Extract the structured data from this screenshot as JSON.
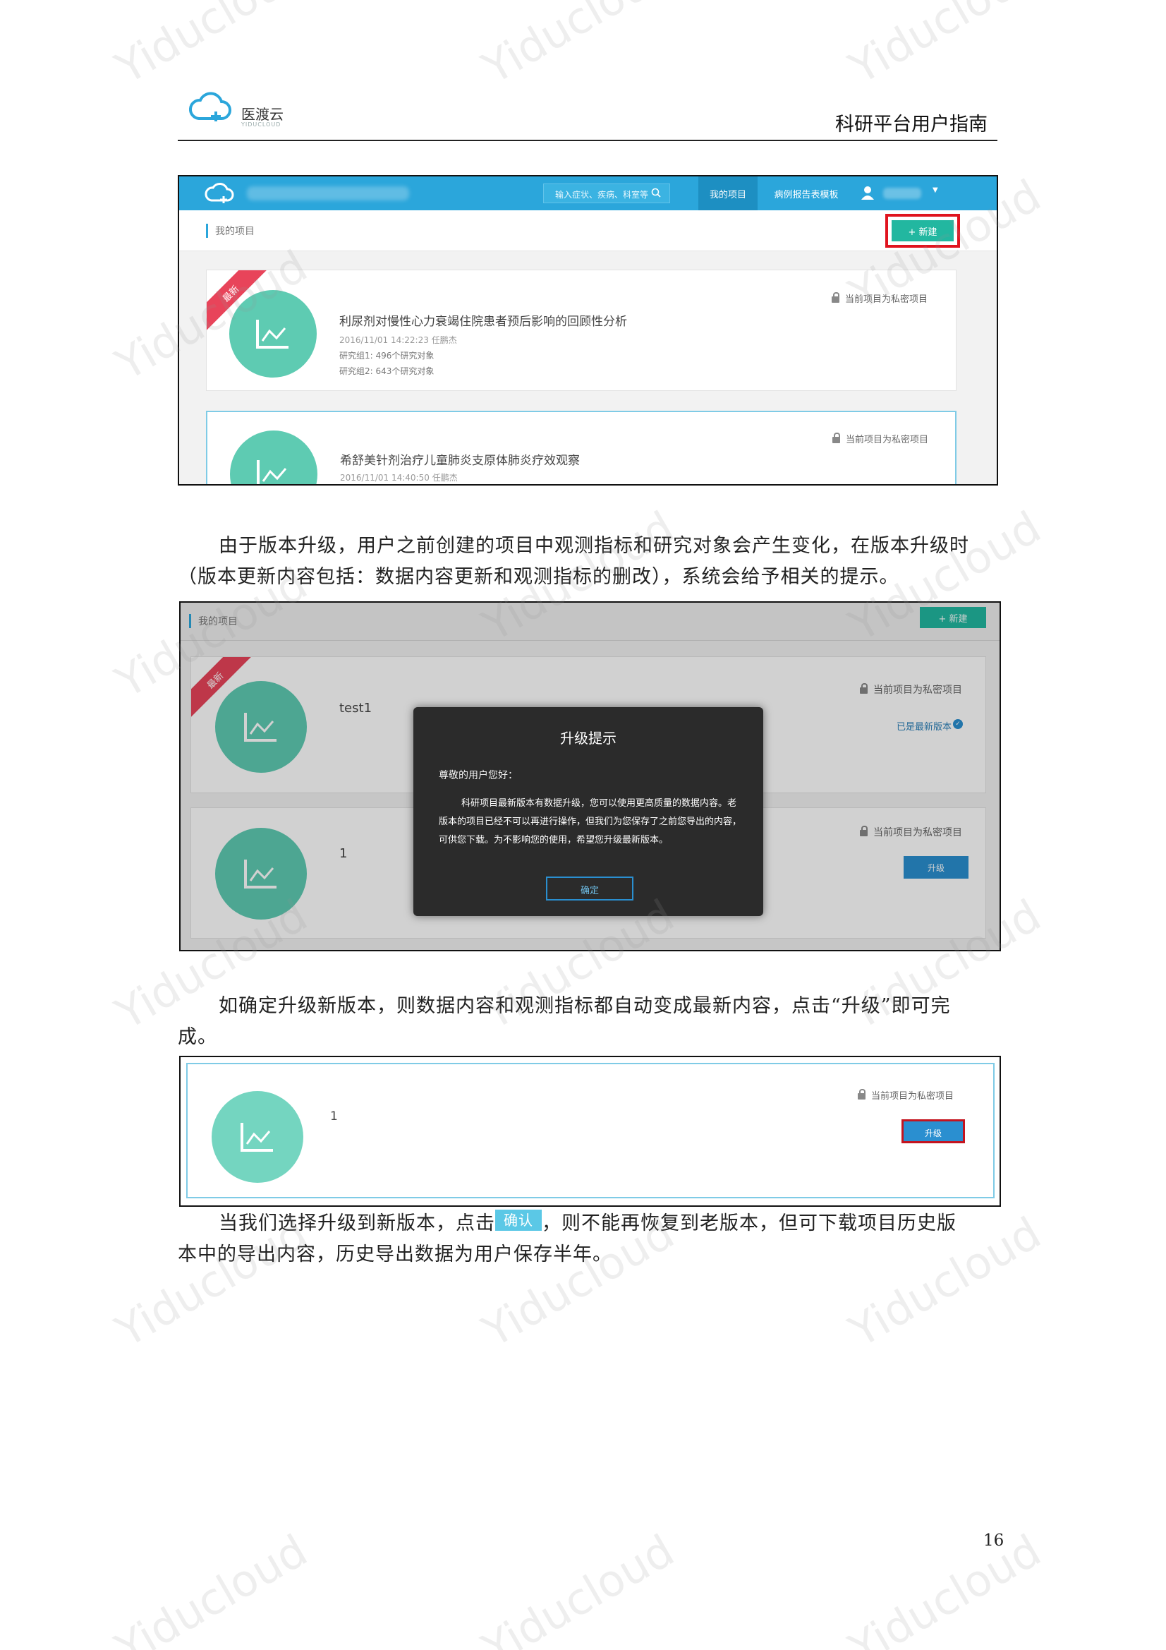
{
  "header": {
    "logo_cn": "医渡云",
    "logo_en": "YIDUCLOUD",
    "doc_title": "科研平台用户指南"
  },
  "figure1": {
    "search_placeholder": "输入症状、疾病、科室等",
    "nav_my_projects": "我的项目",
    "nav_crf_template": "病例报告表模板",
    "page_title": "我的项目",
    "new_button": "+ 新建",
    "projects": [
      {
        "ribbon": "最新",
        "privacy": "当前项目为私密项目",
        "title": "利尿剂对慢性心力衰竭住院患者预后影响的回顾性分析",
        "meta": "2016/11/01 14:22:23 任鹏杰",
        "group1": "研究组1: 496个研究对象",
        "group2": "研究组2: 643个研究对象"
      },
      {
        "privacy": "当前项目为私密项目",
        "title": "希舒美针剂治疗儿童肺炎支原体肺炎疗效观察",
        "meta": "2016/11/01 14:40:50 任鹏杰"
      }
    ]
  },
  "para1": {
    "line1": "由于版本升级，用户之前创建的项目中观测指标和研究对象会产生变化，在版本升级时",
    "line2": "（版本更新内容包括：数据内容更新和观测指标的删改），系统会给予相关的提示。"
  },
  "figure2": {
    "page_title": "我的项目",
    "new_button": "+ 新建",
    "projects": [
      {
        "ribbon": "最新",
        "name": "test1",
        "privacy": "当前项目为私密项目",
        "status": "已是最新版本"
      },
      {
        "name": "1",
        "privacy": "当前项目为私密项目",
        "action": "升级"
      }
    ],
    "modal": {
      "title": "升级提示",
      "greeting": "尊敬的用户您好：",
      "body": "科研项目最新版本有数据升级，您可以使用更高质量的数据内容。老版本的项目已经不可以再进行操作，但我们为您保存了之前您导出的内容，可供您下载。为不影响您的使用，希望您升级最新版本。",
      "ok": "确定"
    }
  },
  "para2": {
    "line1": "如确定升级新版本，则数据内容和观测指标都自动变成最新内容，点击“升级”即可完",
    "line2": "成。"
  },
  "figure3": {
    "name": "1",
    "privacy": "当前项目为私密项目",
    "action": "升级"
  },
  "para3": {
    "line1_before": "当我们选择升级到新版本，点击",
    "chip": "确认",
    "line1_after": "，则不能再恢复到老版本，但可下载项目历史版",
    "line2": "本中的导出内容，历史导出数据为用户保存半年。"
  },
  "page_number": "16",
  "watermark_text": "Yiducloud",
  "colors": {
    "topbar": "#2ba6db",
    "teal_circle": "#5ecbb2",
    "new_button": "#22b7a0",
    "highlight_red": "#e0141f",
    "ribbon": "#e8445a",
    "upgrade_button": "#2a8fd0"
  }
}
